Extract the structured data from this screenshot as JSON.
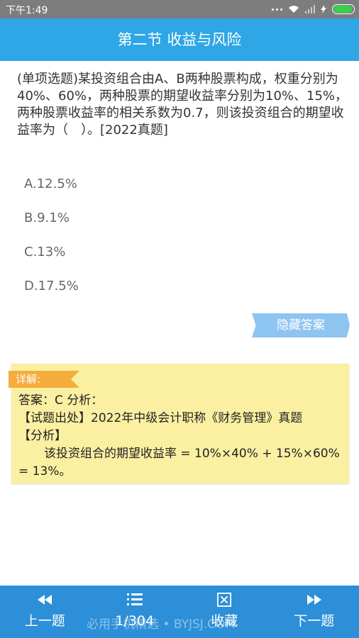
{
  "status_bar": {
    "time": "下午1:49"
  },
  "title_bar": {
    "title": "第二节 收益与风险"
  },
  "question": {
    "text": "(单项选题)某投资组合由A、B两种股票构成，权重分别为40%、60%，两种股票的期望收益率分别为10%、15%，两种股票收益率的相关系数为0.7，则该投资组合的期望收益率为（　）。[2022真题]",
    "options": [
      {
        "label": "A.12.5%"
      },
      {
        "label": "B.9.1%"
      },
      {
        "label": "C.13%"
      },
      {
        "label": "D.17.5%"
      }
    ]
  },
  "hide_answer_button": {
    "label": "隐藏答案"
  },
  "explanation": {
    "tag": "详解:",
    "answer_line": "答案：C 分析：",
    "source_line": "【试题出处】2022年中级会计职称《财务管理》真题",
    "analysis_heading": "【分析】",
    "analysis_text": "该投资组合的期望收益率 = 10%×40% + 15%×60% = 13%。"
  },
  "bottom_nav": {
    "prev": {
      "label": "上一题",
      "icon": "prev-icon"
    },
    "progress": {
      "label": "1/304",
      "icon": "list-icon"
    },
    "favorite": {
      "label": "收藏",
      "icon": "favorite-box-icon"
    },
    "next": {
      "label": "下一题",
      "icon": "next-icon"
    }
  },
  "watermark": "必用手机精选 • BYJSJ.COM",
  "colors": {
    "title_bar": "#2fa6e6",
    "bottom_nav": "#2c8fd8",
    "explanation_bg": "#fbf0a2",
    "explanation_tag": "#f5ac3b",
    "hide_button": "#8ec4f0"
  }
}
